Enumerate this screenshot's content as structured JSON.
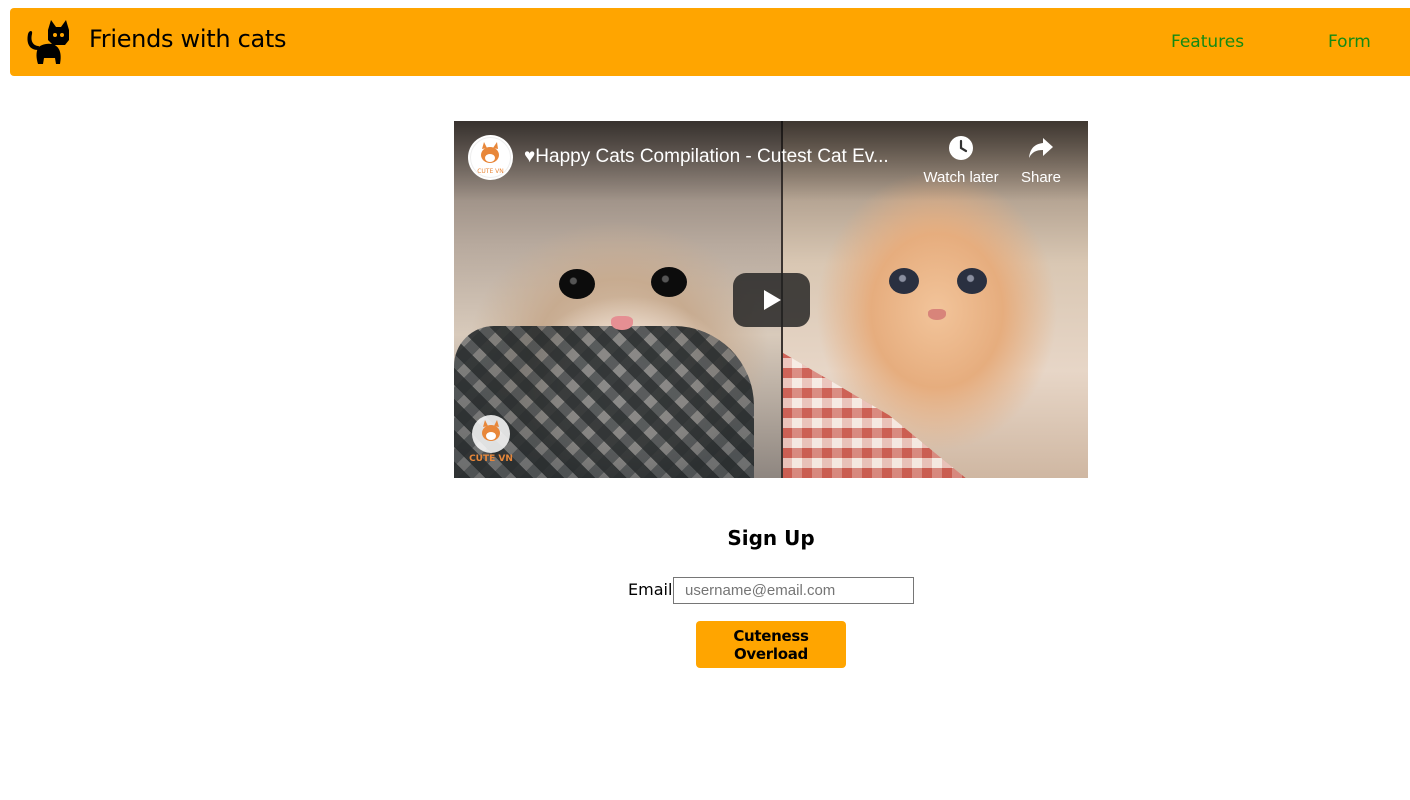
{
  "header": {
    "brand": "Friends with cats",
    "logo_icon": "cat-silhouette-icon",
    "nav": [
      {
        "label": "Features"
      },
      {
        "label": "Form"
      }
    ],
    "colors": {
      "background": "#ffa500",
      "nav_link": "#138a13"
    }
  },
  "video": {
    "title": "♥Happy Cats Compilation - Cutest Cat Ev...",
    "watch_later": "Watch later",
    "share": "Share",
    "channel_watermark": "CUTE VN",
    "icons": {
      "watch_later": "clock-icon",
      "share": "share-arrow-icon",
      "play": "play-icon"
    }
  },
  "form": {
    "title": "Sign Up",
    "email_label": "Email:",
    "email_placeholder": "username@email.com",
    "email_value": "",
    "submit_label": "Cuteness Overload",
    "button_color": "#ffa500"
  }
}
